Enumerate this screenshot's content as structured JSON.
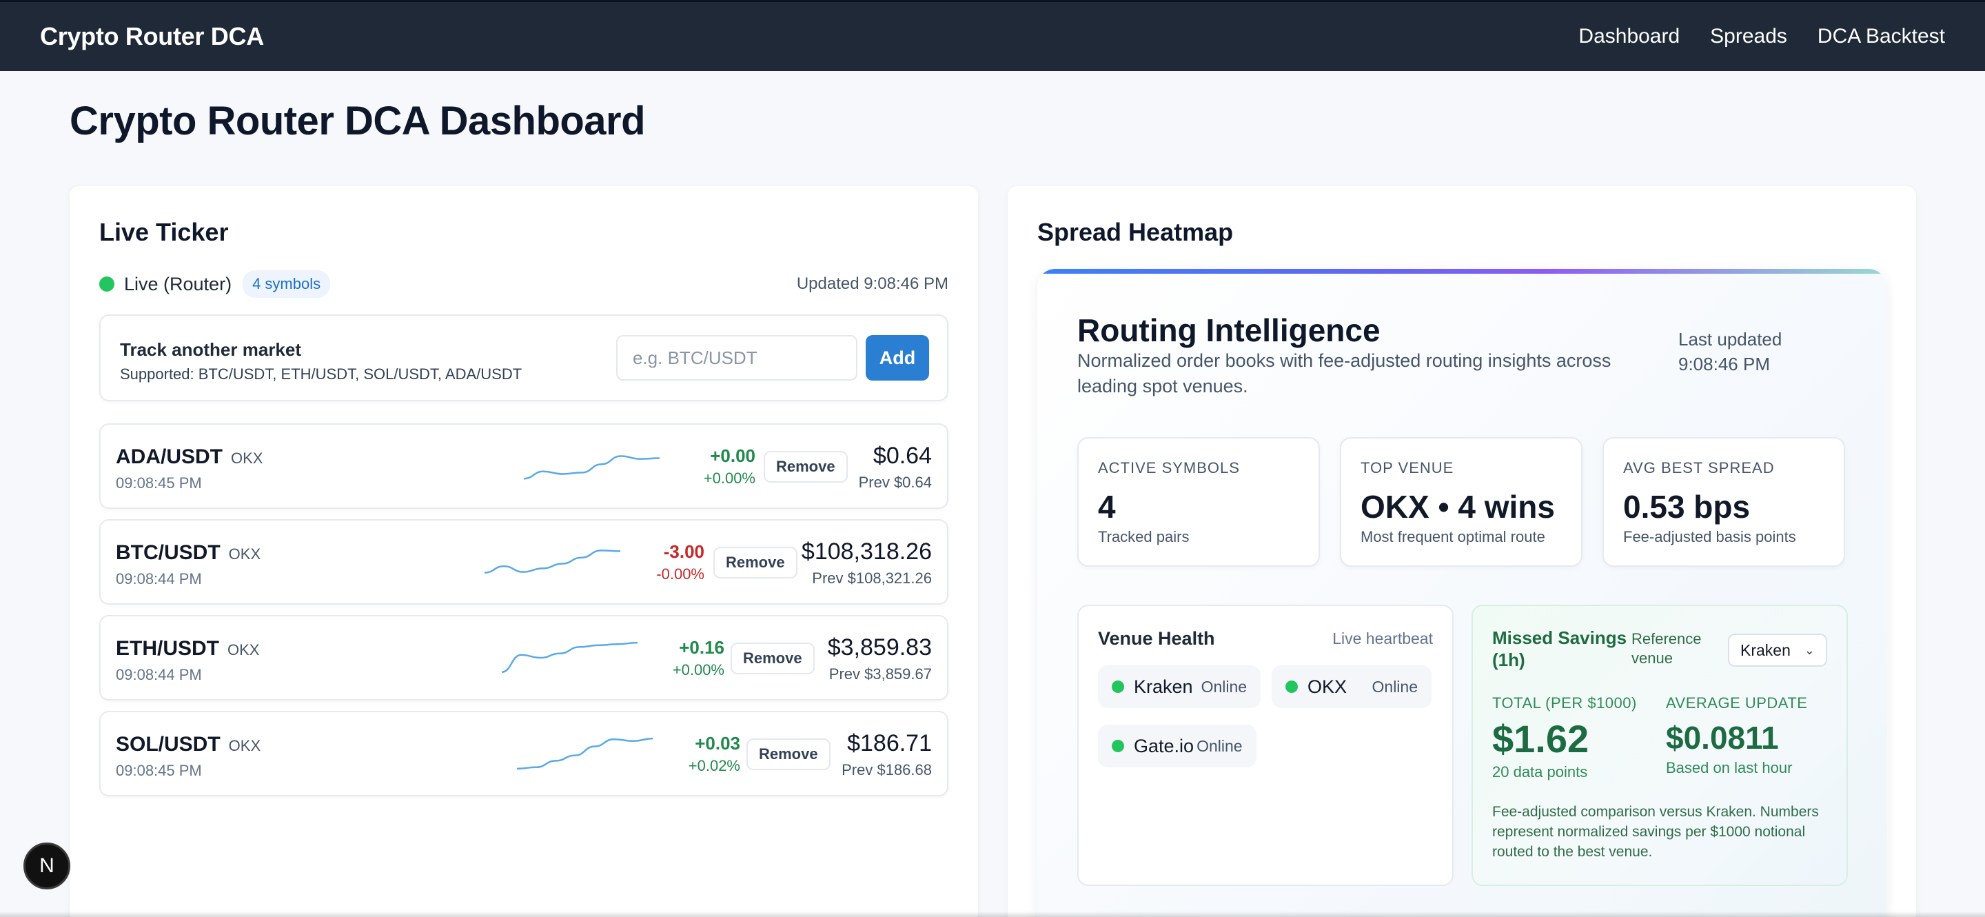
{
  "nav": {
    "brand": "Crypto Router DCA",
    "links": [
      "Dashboard",
      "Spreads",
      "DCA Backtest"
    ]
  },
  "page": {
    "title": "Crypto Router DCA Dashboard"
  },
  "ticker": {
    "title": "Live Ticker",
    "live_label": "Live (Router)",
    "symbol_count": "4 symbols",
    "updated": "Updated 9:08:46 PM",
    "track": {
      "title": "Track another market",
      "supported": "Supported: BTC/USDT, ETH/USDT, SOL/USDT, ADA/USDT",
      "placeholder": "e.g. BTC/USDT",
      "add_label": "Add"
    },
    "remove_label": "Remove",
    "rows": [
      {
        "symbol": "ADA/USDT",
        "venue": "OKX",
        "time": "09:08:45 PM",
        "change": "+0.00",
        "change_pct": "+0.00%",
        "direction": "up",
        "price": "$0.64",
        "prev": "Prev $0.64",
        "spark": [
          0.15,
          0.35,
          0.28,
          0.32,
          0.55,
          0.78,
          0.7,
          0.72
        ]
      },
      {
        "symbol": "BTC/USDT",
        "venue": "OKX",
        "time": "09:08:44 PM",
        "change": "-3.00",
        "change_pct": "-0.00%",
        "direction": "down",
        "price": "$108,318.26",
        "prev": "Prev $108,321.26",
        "spark": [
          0.2,
          0.38,
          0.22,
          0.32,
          0.45,
          0.62,
          0.82,
          0.8
        ]
      },
      {
        "symbol": "ETH/USDT",
        "venue": "OKX",
        "time": "09:08:44 PM",
        "change": "+0.16",
        "change_pct": "+0.00%",
        "direction": "up",
        "price": "$3,859.83",
        "prev": "Prev $3,859.67",
        "spark": [
          0.1,
          0.58,
          0.5,
          0.62,
          0.8,
          0.85,
          0.88,
          0.92
        ]
      },
      {
        "symbol": "SOL/USDT",
        "venue": "OKX",
        "time": "09:08:45 PM",
        "change": "+0.03",
        "change_pct": "+0.02%",
        "direction": "up",
        "price": "$186.71",
        "prev": "Prev $186.68",
        "spark": [
          0.08,
          0.12,
          0.3,
          0.45,
          0.7,
          0.9,
          0.85,
          0.92
        ]
      }
    ]
  },
  "spread": {
    "title": "Spread Heatmap",
    "routing": {
      "title": "Routing Intelligence",
      "subtitle": "Normalized order books with fee-adjusted routing insights across leading spot venues.",
      "last_updated_label": "Last updated",
      "last_updated_time": "9:08:46 PM",
      "stats": [
        {
          "label": "ACTIVE SYMBOLS",
          "value": "4",
          "note": "Tracked pairs"
        },
        {
          "label": "TOP VENUE",
          "value": "OKX • 4 wins",
          "note": "Most frequent optimal route"
        },
        {
          "label": "AVG BEST SPREAD",
          "value": "0.53 bps",
          "note": "Fee-adjusted basis points"
        }
      ],
      "health": {
        "title": "Venue Health",
        "heartbeat": "Live heartbeat",
        "venues": [
          {
            "name": "Kraken",
            "status": "Online"
          },
          {
            "name": "OKX",
            "status": "Online"
          },
          {
            "name": "Gate.io",
            "status": "Online"
          }
        ]
      },
      "missed": {
        "title": "Missed Savings (1h)",
        "reference_label": "Reference venue",
        "reference_value": "Kraken",
        "total_label": "TOTAL (PER $1000)",
        "total_value": "$1.62",
        "total_note": "20 data points",
        "avg_label": "AVERAGE UPDATE",
        "avg_value": "$0.0811",
        "avg_note": "Based on last hour",
        "footnote": "Fee-adjusted comparison versus Kraken. Numbers represent normalized savings per $1000 notional routed to the best venue."
      }
    }
  },
  "badge": "N",
  "colors": {
    "nav_bg": "#1f2937",
    "accent": "#2b7fd3",
    "positive": "#1f8a4c",
    "negative": "#c62828",
    "spark": "#5aa9e6"
  }
}
